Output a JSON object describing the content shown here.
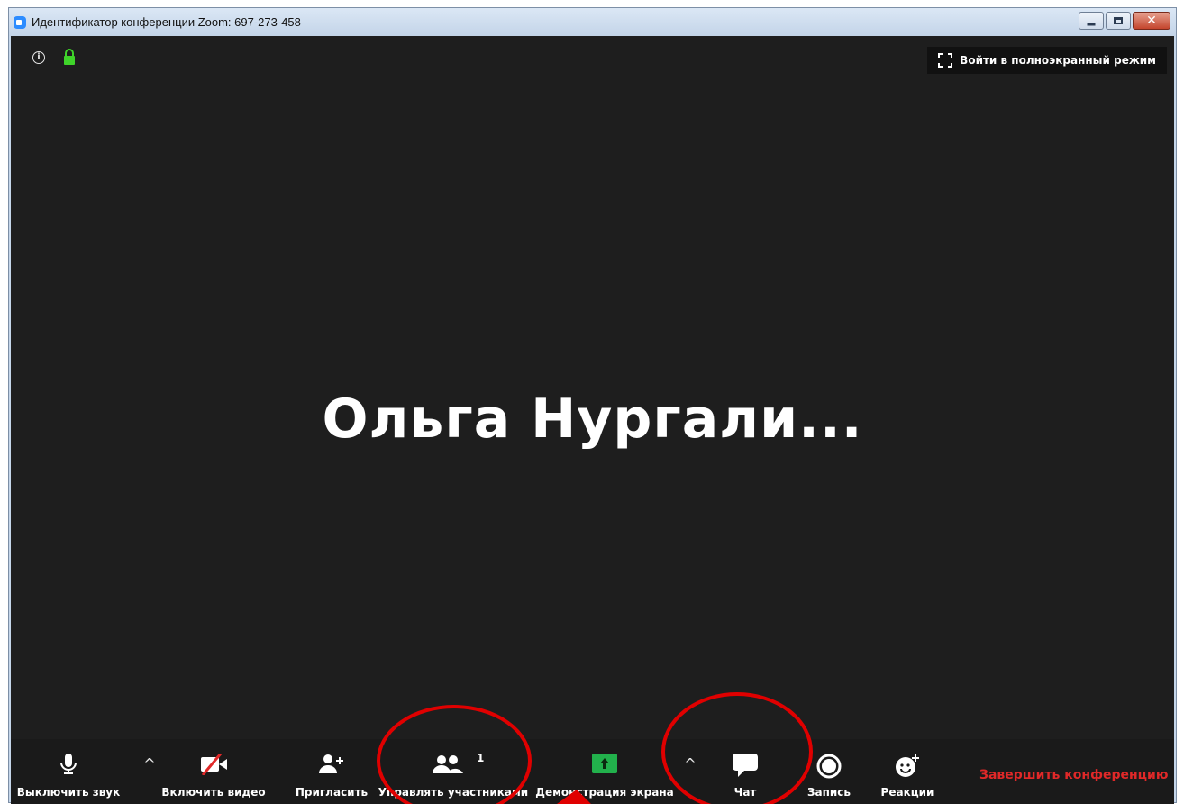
{
  "window": {
    "title": "Идентификатор конференции Zoom: 697-273-458"
  },
  "stage": {
    "fullscreen_label": "Войти в полноэкранный режим",
    "participant_name": "Ольга  Нургали..."
  },
  "toolbar": {
    "mute_label": "Выключить звук",
    "video_label": "Включить видео",
    "invite_label": "Пригласить",
    "participants_label": "Управлять участниками",
    "participants_count": "1",
    "share_label": "Демонстрация экрана",
    "chat_label": "Чат",
    "record_label": "Запись",
    "reactions_label": "Реакции",
    "end_label": "Завершить конференцию",
    "caret_glyph": "^"
  },
  "colors": {
    "stage_bg": "#1e1e1e",
    "toolbar_bg": "#1a1a1a",
    "share_green": "#22b14c",
    "end_red": "#e02828",
    "lock_green": "#3fd42a",
    "annotation_red": "#e00000"
  },
  "icons": [
    "info-icon",
    "lock-icon",
    "fullscreen-icon",
    "microphone-icon",
    "video-off-icon",
    "add-user-icon",
    "participants-icon",
    "share-screen-icon",
    "chat-icon",
    "record-icon",
    "reactions-icon"
  ]
}
